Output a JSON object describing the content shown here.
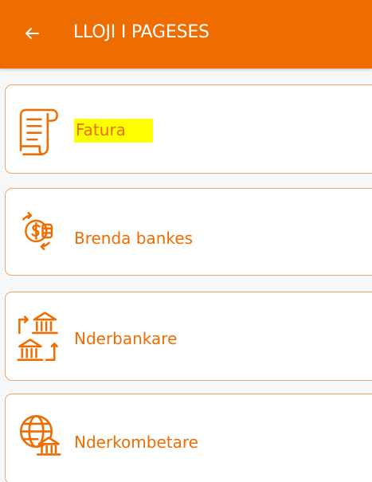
{
  "app_bar": {
    "title": "LLOJI I PAGESES",
    "back_icon": "arrow-left-icon",
    "color": "#ef6c00"
  },
  "payment_types": [
    {
      "label": "Fatura",
      "icon": "invoice-receipt-icon",
      "highlighted": true
    },
    {
      "label": "Brenda bankes",
      "icon": "currency-exchange-icon",
      "highlighted": false
    },
    {
      "label": "Nderbankare",
      "icon": "interbank-transfer-icon",
      "highlighted": false
    },
    {
      "label": "Nderkombetare",
      "icon": "international-globe-bank-icon",
      "highlighted": false
    }
  ],
  "colors": {
    "accent": "#ef6c00",
    "card_border": "#f0a66a",
    "highlight": "#ffff00"
  }
}
